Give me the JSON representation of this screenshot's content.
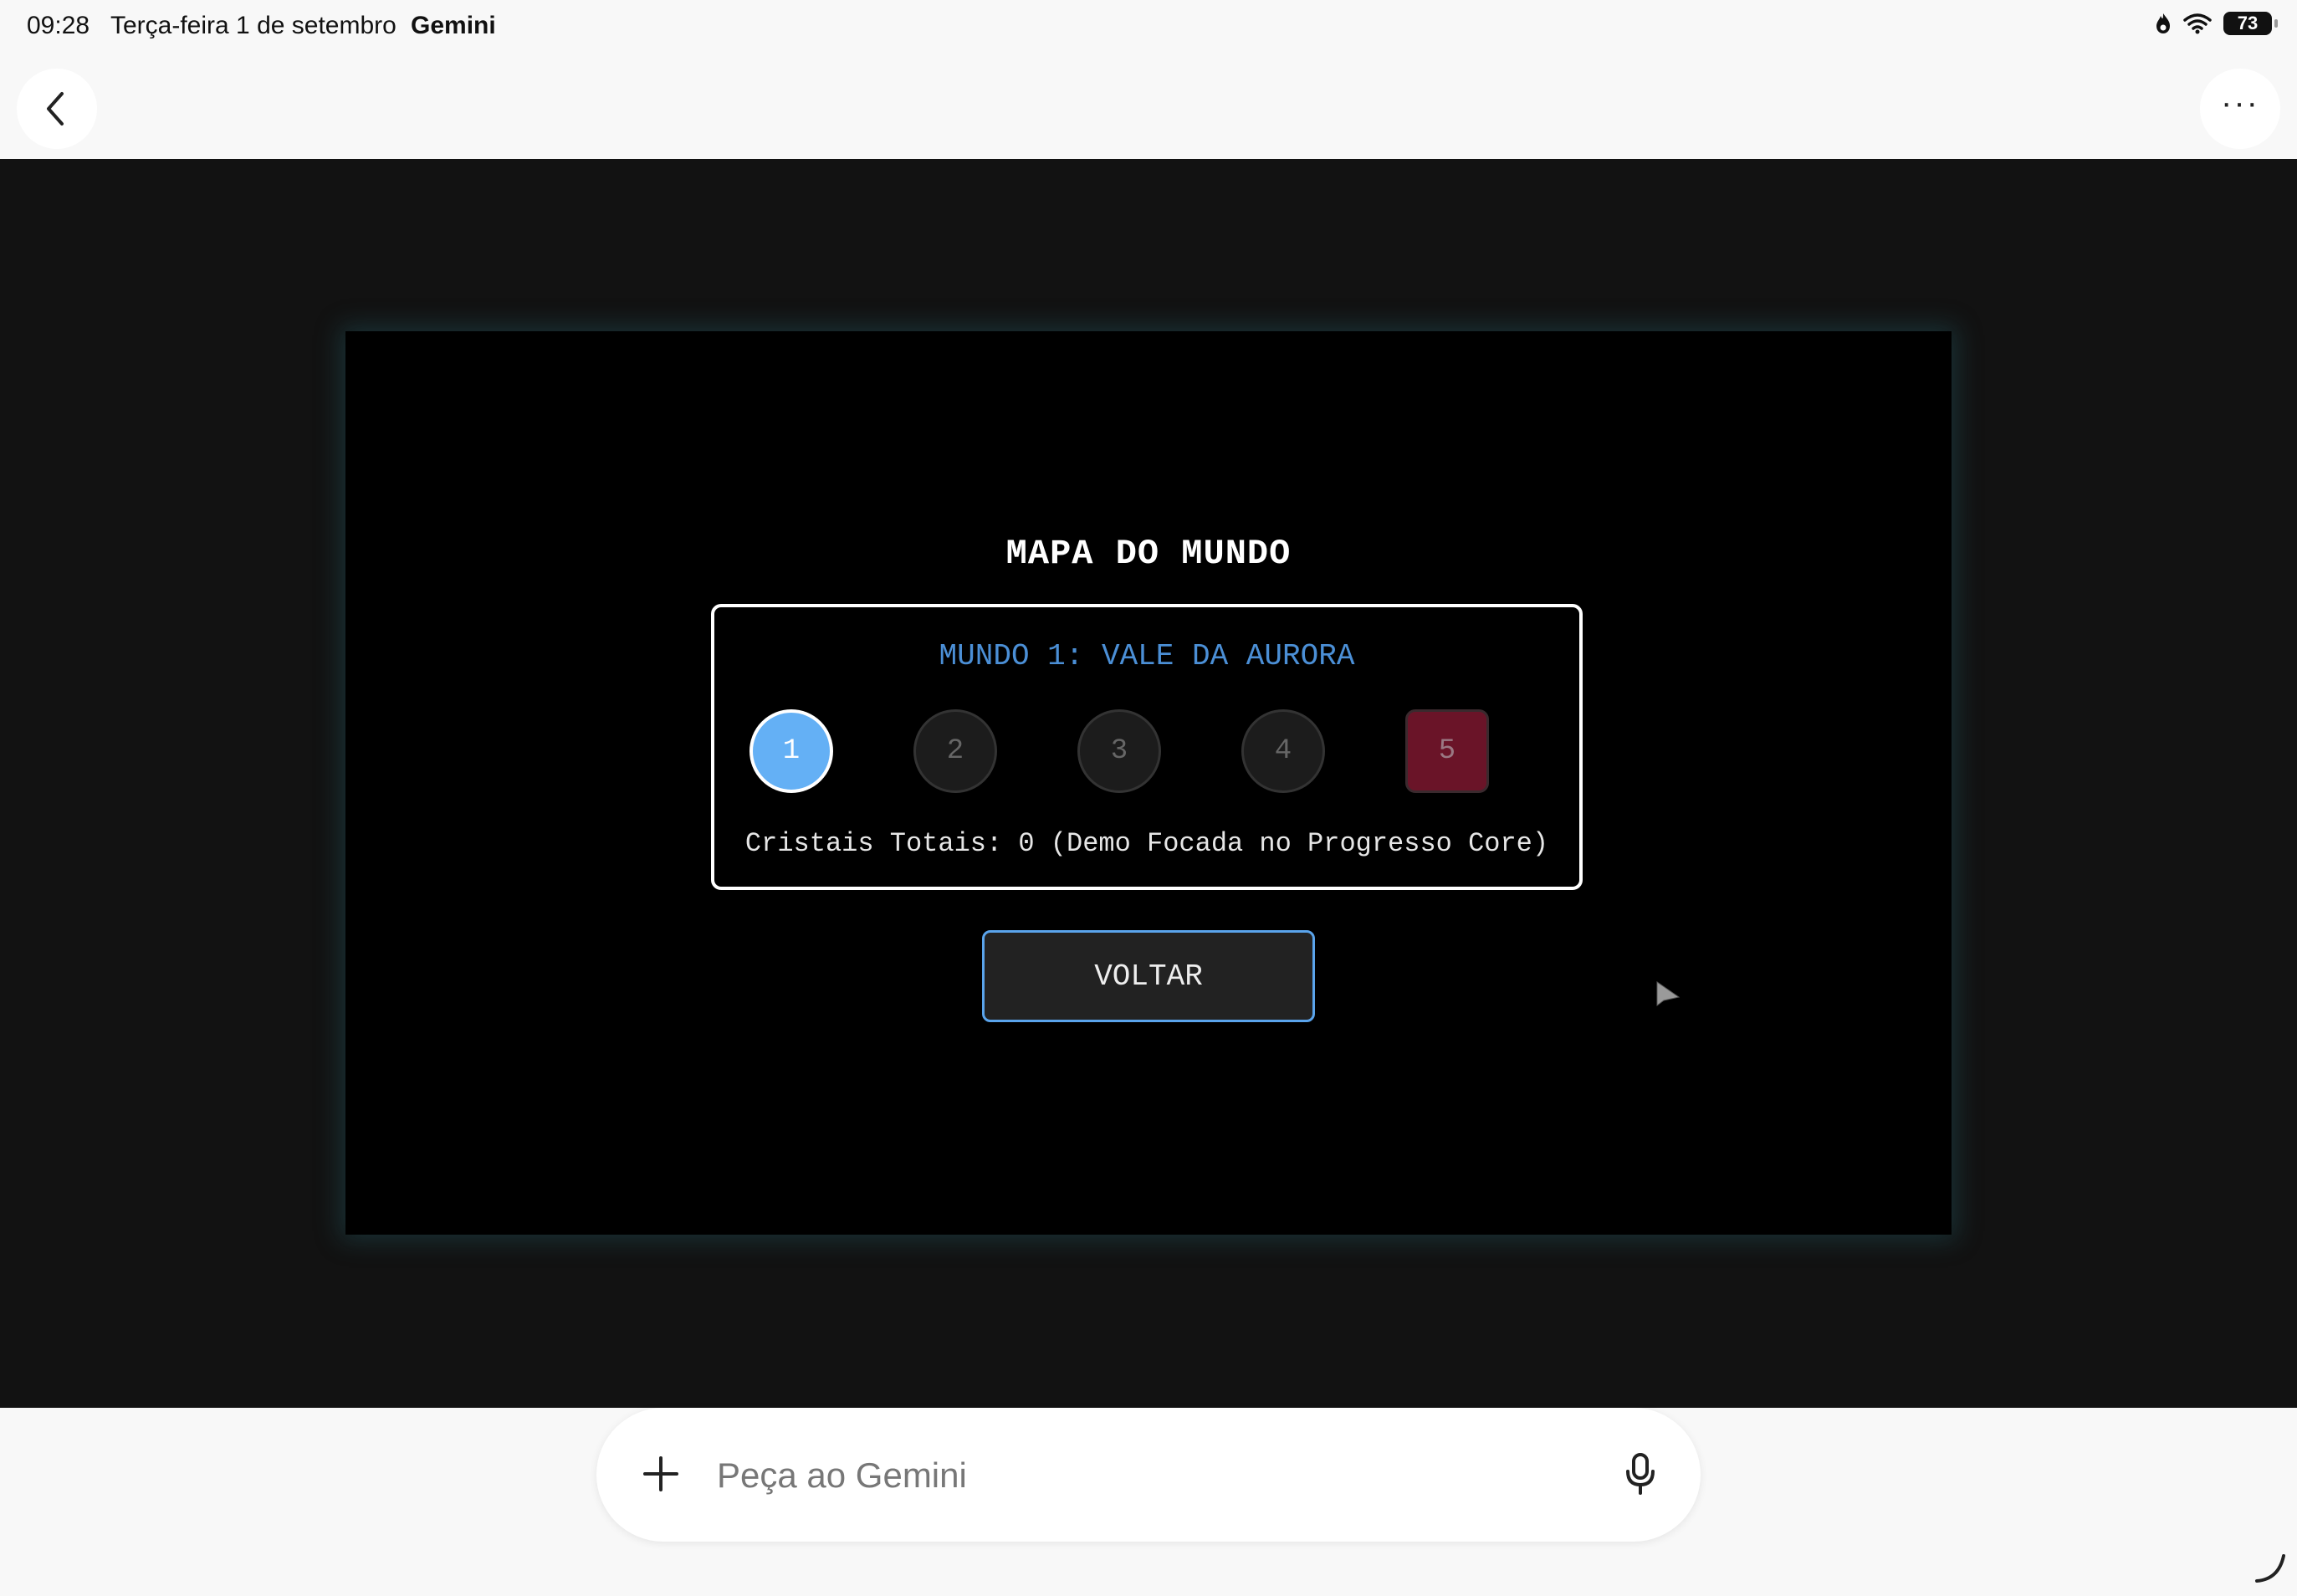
{
  "status_bar": {
    "time": "09:28",
    "date": "Terça-feira 1 de setembro",
    "app": "Gemini",
    "battery": "73"
  },
  "top_bar": {
    "back_icon": "chevron-left-icon",
    "more_icon": "more-horizontal-icon"
  },
  "game": {
    "title": "MAPA DO MUNDO",
    "world_name": "MUNDO 1: VALE DA AURORA",
    "levels": [
      {
        "label": "1",
        "state": "active"
      },
      {
        "label": "2",
        "state": "locked"
      },
      {
        "label": "3",
        "state": "locked"
      },
      {
        "label": "4",
        "state": "locked"
      },
      {
        "label": "5",
        "state": "boss"
      }
    ],
    "crystals_text": "Cristais Totais: 0 (Demo Focada no Progresso Core)",
    "back_button": "VOLTAR",
    "colors": {
      "accent": "#4b8fd6",
      "active_level": "#64b0f5",
      "boss_level": "#6a1428",
      "background": "#000000"
    }
  },
  "prompt": {
    "placeholder": "Peça ao Gemini",
    "plus_icon": "plus-icon",
    "mic_icon": "microphone-icon"
  }
}
